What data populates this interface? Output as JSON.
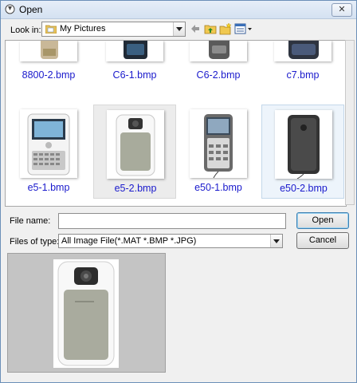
{
  "window": {
    "title": "Open",
    "close_glyph": "✕"
  },
  "toolbar": {
    "look_in_label": "Look in:",
    "look_in_value": "My Pictures",
    "icons": [
      "back-arrow-icon",
      "up-folder-icon",
      "new-folder-icon",
      "view-menu-icon"
    ]
  },
  "files_top": [
    {
      "name": "8800-2.bmp"
    },
    {
      "name": "C6-1.bmp"
    },
    {
      "name": "C6-2.bmp"
    },
    {
      "name": "c7.bmp"
    }
  ],
  "files": [
    {
      "name": "e5-1.bmp",
      "state": "normal"
    },
    {
      "name": "e5-2.bmp",
      "state": "hover"
    },
    {
      "name": "e50-1.bmp",
      "state": "normal"
    },
    {
      "name": "e50-2.bmp",
      "state": "selected"
    }
  ],
  "form": {
    "file_name_label": "File name:",
    "file_name_value": "",
    "file_type_label": "Files of type:",
    "file_type_value": "All Image File(*.MAT *.BMP *.JPG)"
  },
  "buttons": {
    "open": "Open",
    "cancel": "Cancel"
  },
  "colors": {
    "link_blue": "#1a1acc",
    "selection_blue": "#edf4fb",
    "title_bar": "#d9e4f2"
  }
}
